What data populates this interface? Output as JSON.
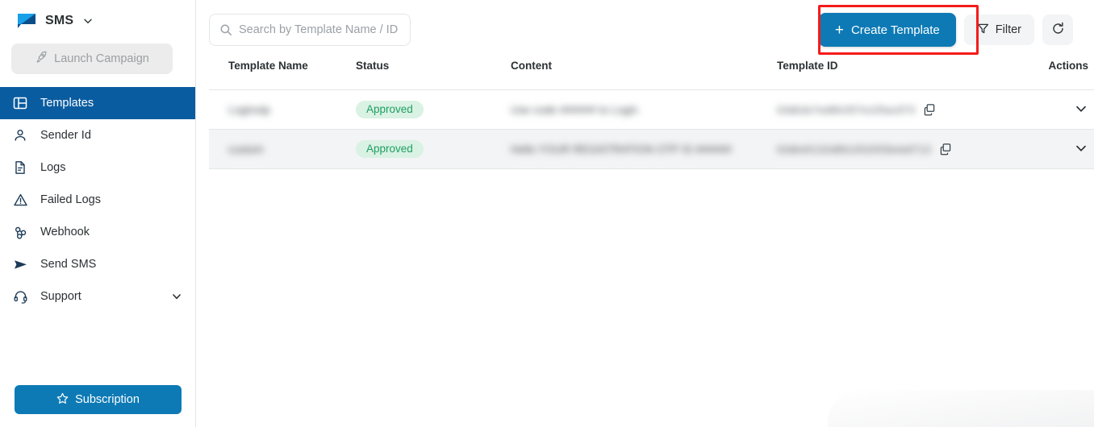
{
  "sidebar": {
    "brand": {
      "name": "SMS",
      "logo_icon": "sms-logo-icon",
      "caret_icon": "chevron-down-icon"
    },
    "launch_campaign": {
      "label": "Launch Campaign",
      "icon": "rocket-icon",
      "disabled": true
    },
    "items": [
      {
        "label": "Templates",
        "icon": "layout-panel-icon",
        "active": true
      },
      {
        "label": "Sender Id",
        "icon": "user-icon",
        "active": false
      },
      {
        "label": "Logs",
        "icon": "document-icon",
        "active": false
      },
      {
        "label": "Failed Logs",
        "icon": "warning-triangle-icon",
        "active": false
      },
      {
        "label": "Webhook",
        "icon": "webhook-icon",
        "active": false
      },
      {
        "label": "Send SMS",
        "icon": "send-paperplane-icon",
        "active": false
      },
      {
        "label": "Support",
        "icon": "headset-icon",
        "active": false,
        "expandable": true,
        "chevron_icon": "chevron-down-icon"
      }
    ],
    "subscription": {
      "label": "Subscription",
      "icon": "star-icon"
    }
  },
  "toolbar": {
    "search": {
      "value": "",
      "placeholder": "Search by Template Name / ID",
      "icon": "search-icon"
    },
    "create_template": {
      "label": "Create Template",
      "icon": "plus-icon",
      "highlighted": true
    },
    "filter": {
      "label": "Filter",
      "icon": "funnel-icon"
    },
    "refresh": {
      "label": "",
      "icon": "refresh-icon"
    }
  },
  "table": {
    "columns": [
      "Template Name",
      "Status",
      "Content",
      "Template ID",
      "Actions"
    ],
    "rows": [
      {
        "name": "Loginotp",
        "status": "Approved",
        "content": "Use code ###### to Login",
        "template_id": "63db3e7ed6fc057e105ac973",
        "copy_icon": "copy-icon",
        "expand_icon": "chevron-down-icon"
      },
      {
        "name": "custom",
        "status": "Approved",
        "content": "Hello YOUR REGISTRATION OTP IS ######",
        "template_id": "63db40132d861052055b4e8713",
        "copy_icon": "copy-icon",
        "expand_icon": "chevron-down-icon"
      }
    ]
  },
  "colors": {
    "sidebar_active": "#0a5ca0",
    "primary": "#0d7ab5",
    "highlight_box": "#f51b1b",
    "badge_bg": "#d9f2e3",
    "badge_text": "#1f9e63",
    "row_alt_bg": "#f3f4f5"
  }
}
